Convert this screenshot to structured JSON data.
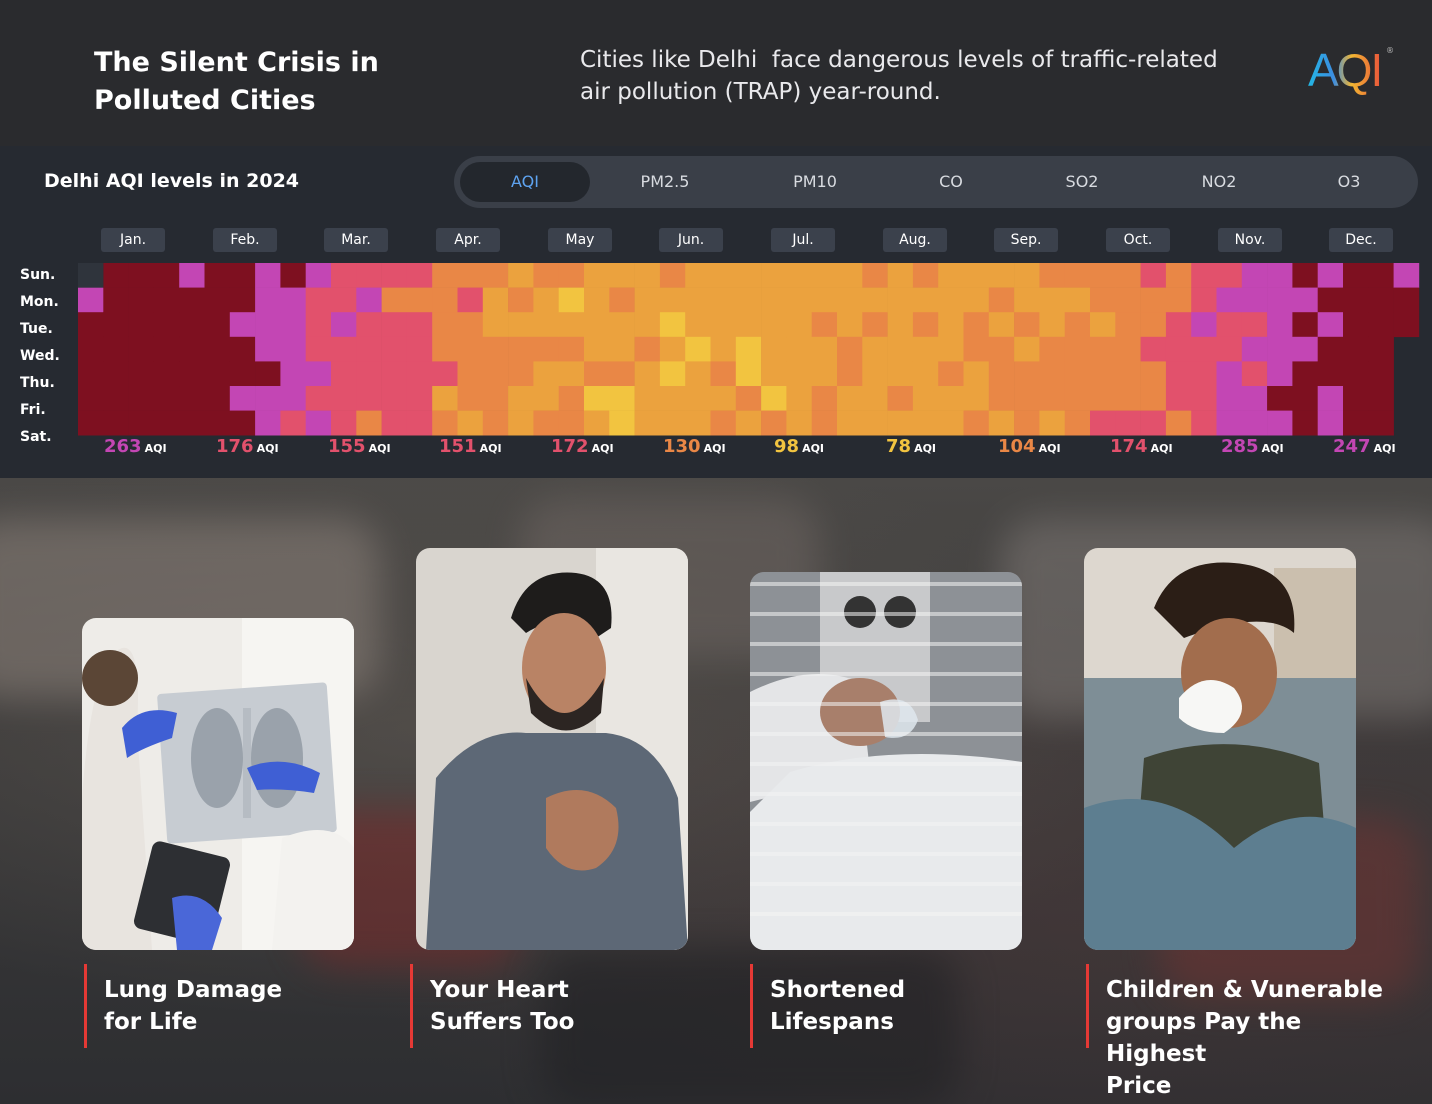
{
  "header": {
    "title_line1": "The Silent Crisis in",
    "title_line2": "Polluted Cities",
    "subtitle_line1": "Cities like Delhi  face dangerous levels of traffic-related",
    "subtitle_line2": "air pollution (TRAP) year-round.",
    "logo_text": "AQI",
    "logo_mark": "®"
  },
  "panel": {
    "title": "Delhi AQI levels in 2024",
    "tabs": [
      {
        "label": "AQI",
        "active": true
      },
      {
        "label": "PM2.5",
        "active": false
      },
      {
        "label": "PM10",
        "active": false
      },
      {
        "label": "CO",
        "active": false
      },
      {
        "label": "SO2",
        "active": false
      },
      {
        "label": "NO2",
        "active": false
      },
      {
        "label": "O3",
        "active": false
      }
    ],
    "days": [
      "Sun.",
      "Mon.",
      "Tue.",
      "Wed.",
      "Thu.",
      "Fri.",
      "Sat."
    ],
    "months": [
      "Jan.",
      "Feb.",
      "Mar.",
      "Apr.",
      "May",
      "Jun.",
      "Jul.",
      "Aug.",
      "Sep.",
      "Oct.",
      "Nov.",
      "Dec."
    ],
    "aqi_unit": "AQI"
  },
  "chart_data": {
    "type": "heatmap",
    "title": "Delhi AQI levels in 2024",
    "year": 2024,
    "x_categories": [
      "Jan.",
      "Feb.",
      "Mar.",
      "Apr.",
      "May",
      "Jun.",
      "Jul.",
      "Aug.",
      "Sep.",
      "Oct.",
      "Nov.",
      "Dec."
    ],
    "y_categories": [
      "Sun.",
      "Mon.",
      "Tue.",
      "Wed.",
      "Thu.",
      "Fri.",
      "Sat."
    ],
    "monthly_average_aqi": [
      263,
      176,
      155,
      151,
      172,
      130,
      98,
      78,
      104,
      174,
      285,
      247
    ],
    "monthly_colors": [
      "#c346b4",
      "#e2516c",
      "#e2516c",
      "#e2516c",
      "#e2516c",
      "#e98746",
      "#f2c440",
      "#f2c440",
      "#e98746",
      "#e2516c",
      "#c346b4",
      "#c346b4"
    ],
    "color_scale": [
      "#f0e43c",
      "#f2c440",
      "#eba23e",
      "#e98746",
      "#e2516c",
      "#c346b4",
      "#7e1020"
    ]
  },
  "cards": [
    {
      "caption_line1": "Lung Damage",
      "caption_line2": "for Life",
      "caption_line3": ""
    },
    {
      "caption_line1": "Your Heart",
      "caption_line2": "Suffers Too",
      "caption_line3": ""
    },
    {
      "caption_line1": "Shortened",
      "caption_line2": "Lifespans",
      "caption_line3": ""
    },
    {
      "caption_line1": "Children & Vunerable",
      "caption_line2": "groups Pay the Highest",
      "caption_line3": "Price"
    }
  ]
}
